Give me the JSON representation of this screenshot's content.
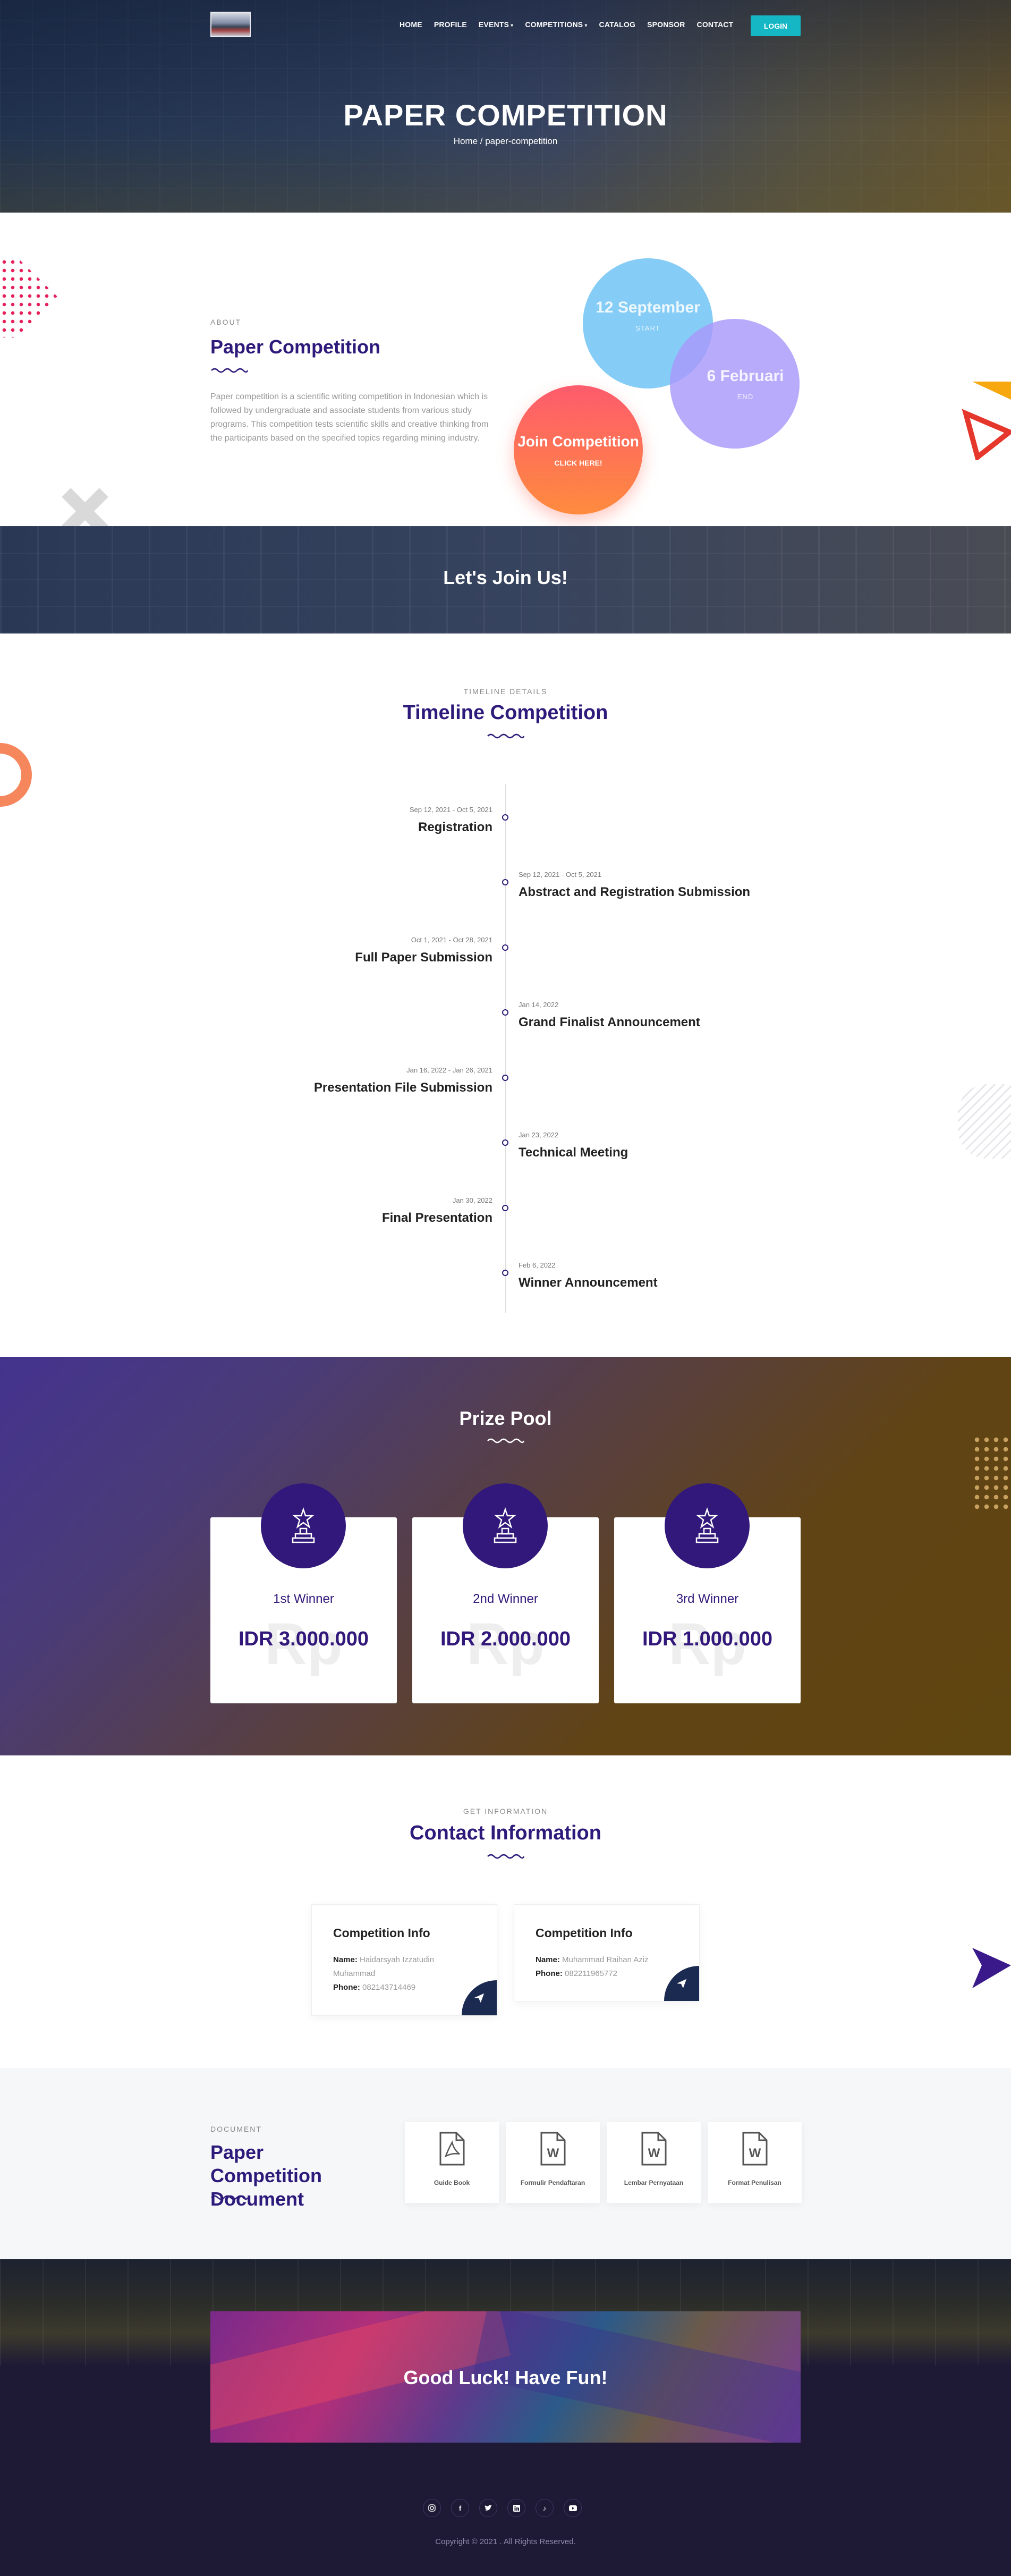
{
  "header": {
    "nav": [
      "HOME",
      "PROFILE",
      "EVENTS",
      "COMPETITIONS",
      "CATALOG",
      "SPONSOR",
      "CONTACT"
    ],
    "login": "LOGIN",
    "title": "PAPER COMPETITION",
    "breadcrumb": "Home / paper-competition"
  },
  "about": {
    "label": "ABOUT",
    "title": "Paper Competition",
    "text": "Paper competition is a scientific writing competition in Indonesian which is followed by undergraduate and associate students from various study programs. This competition tests scientific skills and creative thinking from the participants based on the specified topics regarding mining industry.",
    "start_date": "12 September",
    "start_label": "START",
    "end_date": "6 Februari",
    "end_label": "END",
    "join": "Join Competition",
    "click": "CLICK HERE!"
  },
  "join_banner": "Let's Join Us!",
  "timeline": {
    "label": "TIMELINE DETAILS",
    "title": "Timeline Competition",
    "items": [
      {
        "date": "Sep 12, 2021 - Oct 5, 2021",
        "name": "Registration"
      },
      {
        "date": "Sep 12, 2021 - Oct 5, 2021",
        "name": "Abstract and Registration Submission"
      },
      {
        "date": "Oct 1, 2021 - Oct 28, 2021",
        "name": "Full Paper Submission"
      },
      {
        "date": "Jan 14, 2022",
        "name": "Grand Finalist Announcement"
      },
      {
        "date": "Jan 16, 2022 - Jan 26, 2021",
        "name": "Presentation File Submission"
      },
      {
        "date": "Jan 23, 2022",
        "name": "Technical Meeting"
      },
      {
        "date": "Jan 30, 2022",
        "name": "Final Presentation"
      },
      {
        "date": "Feb 6, 2022",
        "name": "Winner Announcement"
      }
    ]
  },
  "prize": {
    "title": "Prize Pool",
    "watermark": "Rp",
    "cards": [
      {
        "rank": "1st Winner",
        "amount": "IDR 3.000.000"
      },
      {
        "rank": "2nd Winner",
        "amount": "IDR 2.000.000"
      },
      {
        "rank": "3rd Winner",
        "amount": "IDR 1.000.000"
      }
    ]
  },
  "contact": {
    "label": "GET INFORMATION",
    "title": "Contact Information",
    "name_label": "Name:",
    "phone_label": "Phone:",
    "cards": [
      {
        "title": "Competition Info",
        "name": "Haidarsyah Izzatudin Muhammad",
        "phone": "082143714469"
      },
      {
        "title": "Competition Info",
        "name": "Muhammad Raihan Aziz",
        "phone": "082211965772"
      }
    ]
  },
  "document": {
    "label": "DOCUMENT",
    "title": "Paper Competition Document",
    "files": [
      {
        "name": "Guide Book",
        "icon": "pdf-file-icon"
      },
      {
        "name": "Formulir Pendaftaran",
        "icon": "word-file-icon"
      },
      {
        "name": "Lembar Pernyataan",
        "icon": "word-file-icon"
      },
      {
        "name": "Format Penulisan",
        "icon": "word-file-icon"
      }
    ]
  },
  "footer": {
    "banner": "Good Luck! Have Fun!",
    "socials": [
      "instagram-icon",
      "facebook-icon",
      "twitter-icon",
      "linkedin-icon",
      "tiktok-icon",
      "youtube-icon"
    ],
    "copyright": "Copyright © 2021 . All Rights Reserved."
  },
  "colors": {
    "primary": "#2e1a7a",
    "accent": "#16b7c4",
    "orange": "#ff7a45"
  }
}
